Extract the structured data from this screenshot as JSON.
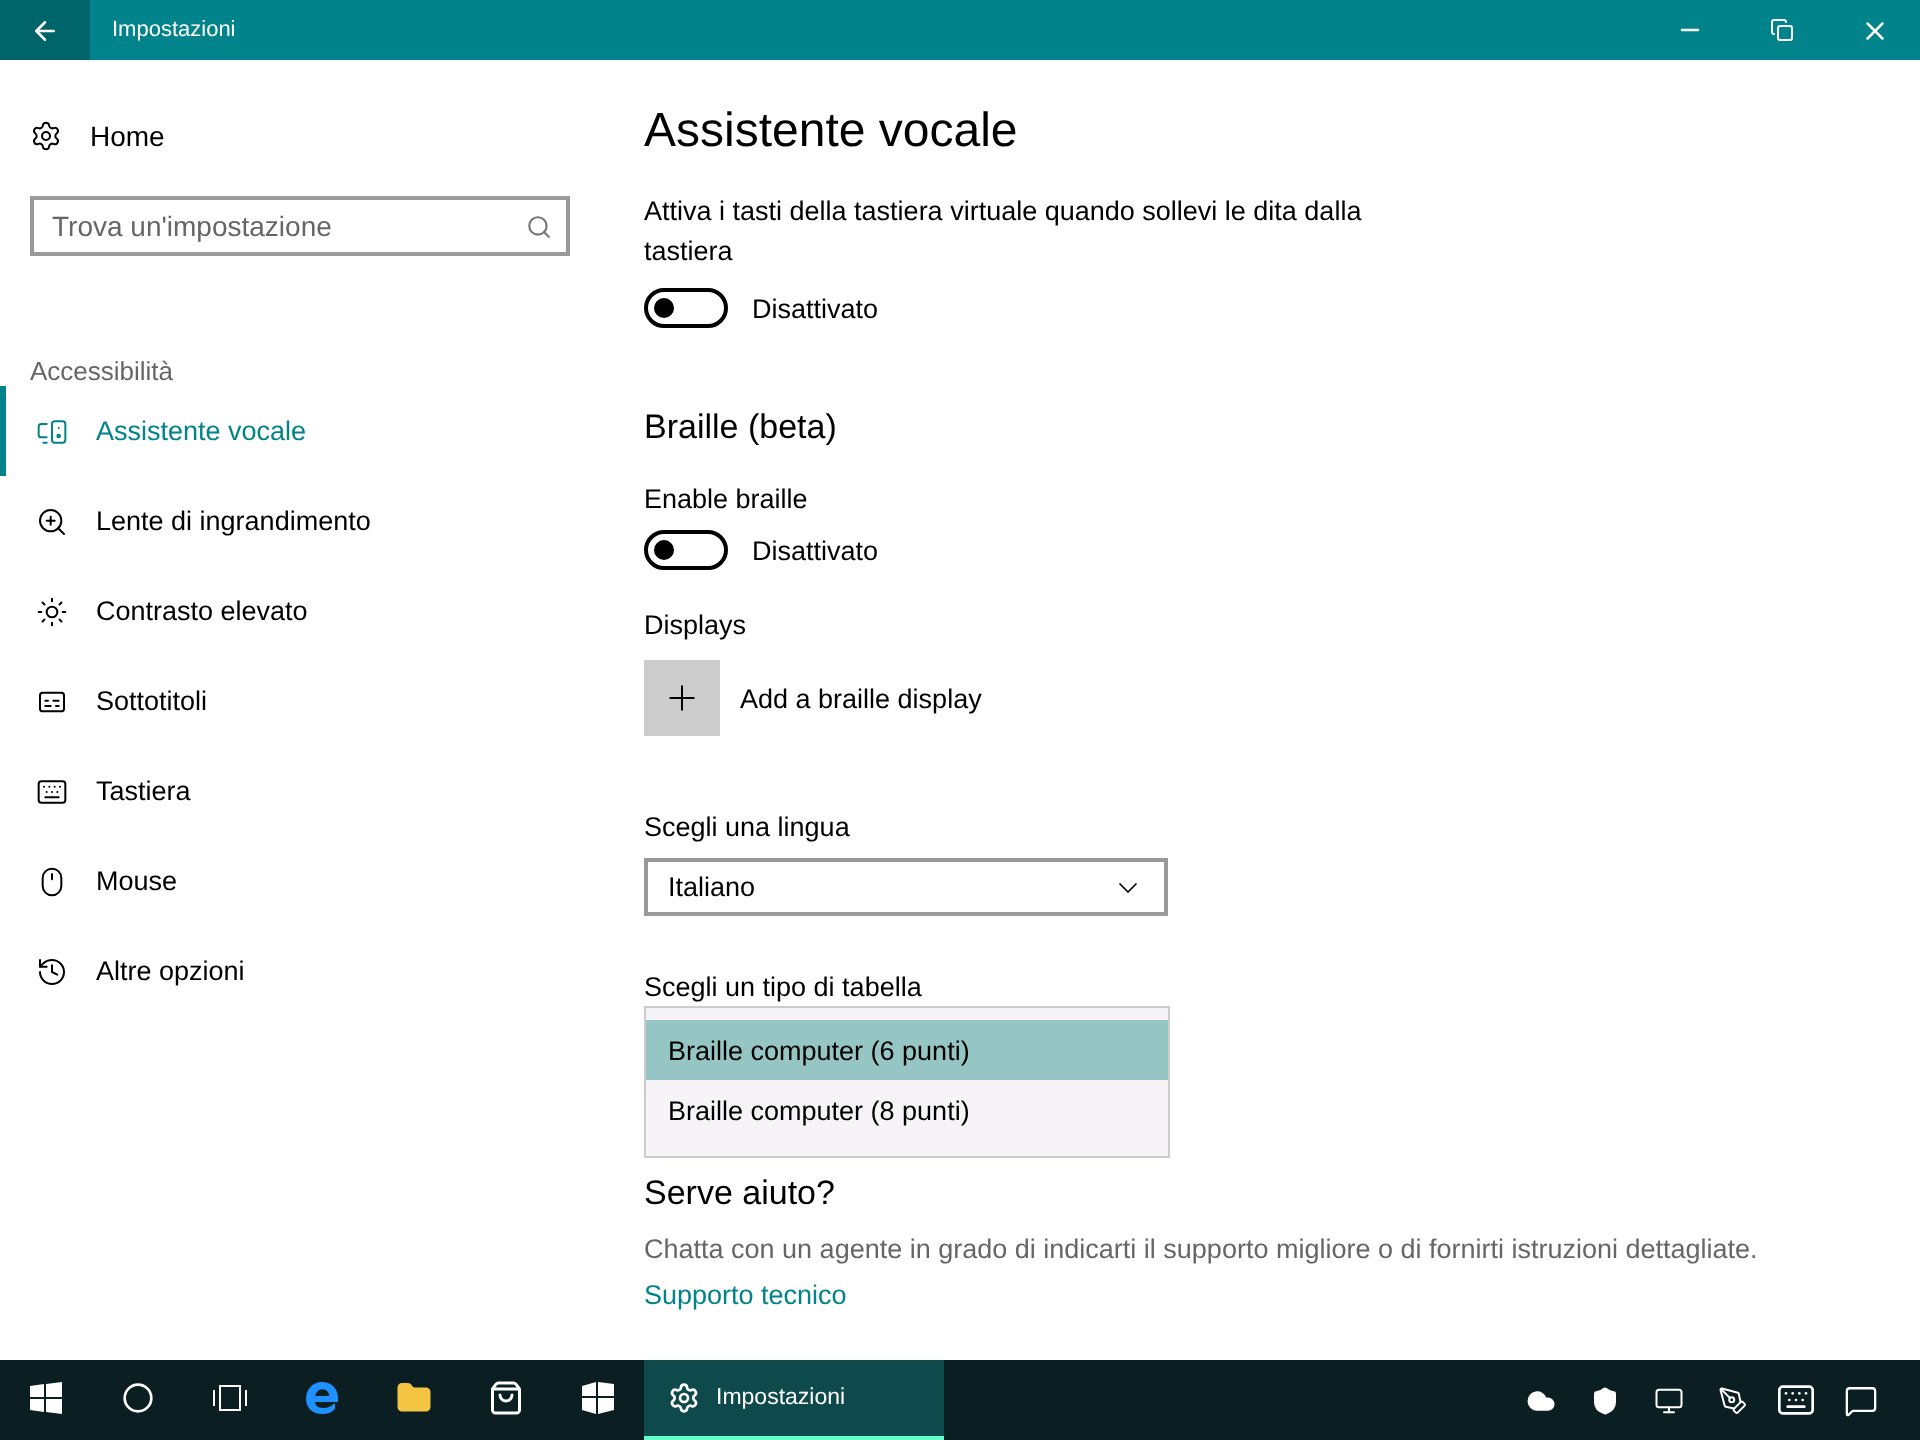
{
  "window": {
    "title": "Impostazioni"
  },
  "sidebar": {
    "home": "Home",
    "search": {
      "placeholder": "Trova un'impostazione"
    },
    "section": "Accessibilità",
    "items": [
      {
        "kind": "narrator",
        "label": "Assistente vocale",
        "selected": true
      },
      {
        "kind": "magnifier",
        "label": "Lente di ingrandimento",
        "selected": false
      },
      {
        "kind": "contrast",
        "label": "Contrasto elevato",
        "selected": false
      },
      {
        "kind": "captions",
        "label": "Sottotitoli",
        "selected": false
      },
      {
        "kind": "keyboard",
        "label": "Tastiera",
        "selected": false
      },
      {
        "kind": "mouse",
        "label": "Mouse",
        "selected": false
      },
      {
        "kind": "other",
        "label": "Altre opzioni",
        "selected": false
      }
    ]
  },
  "main": {
    "title": "Assistente vocale",
    "keys_setting": {
      "label": "Attiva i tasti della tastiera virtuale quando sollevi le dita dalla tastiera",
      "on": false,
      "state": "Disattivato"
    },
    "braille": {
      "heading": "Braille (beta)",
      "enable": {
        "label": "Enable braille",
        "on": false,
        "state": "Disattivato"
      },
      "displays_label": "Displays",
      "add_display": "Add a braille display",
      "language": {
        "label": "Scegli una lingua",
        "value": "Italiano"
      },
      "table": {
        "label": "Scegli un tipo di tabella",
        "options": [
          {
            "label": "Braille computer (6 punti)",
            "selected": true
          },
          {
            "label": "Braille computer (8 punti)",
            "selected": false
          }
        ]
      }
    },
    "help": {
      "heading": "Serve aiuto?",
      "text": "Chatta con un agente in grado di indicarti il supporto migliore o di fornirti istruzioni dettagliate.",
      "link": "Supporto tecnico"
    }
  },
  "taskbar": {
    "apps": [
      {
        "kind": "start",
        "active": false
      },
      {
        "kind": "cortana",
        "active": false
      },
      {
        "kind": "taskview",
        "active": false
      },
      {
        "kind": "edge",
        "active": false
      },
      {
        "kind": "explorer",
        "active": false
      },
      {
        "kind": "store",
        "active": false
      },
      {
        "kind": "tiles",
        "active": false
      },
      {
        "kind": "settings",
        "active": true,
        "label": "Impostazioni"
      }
    ],
    "tray": [
      {
        "kind": "onedrive"
      },
      {
        "kind": "defender"
      },
      {
        "kind": "network"
      },
      {
        "kind": "pen"
      },
      {
        "kind": "keyboard"
      },
      {
        "kind": "notifications"
      }
    ]
  }
}
